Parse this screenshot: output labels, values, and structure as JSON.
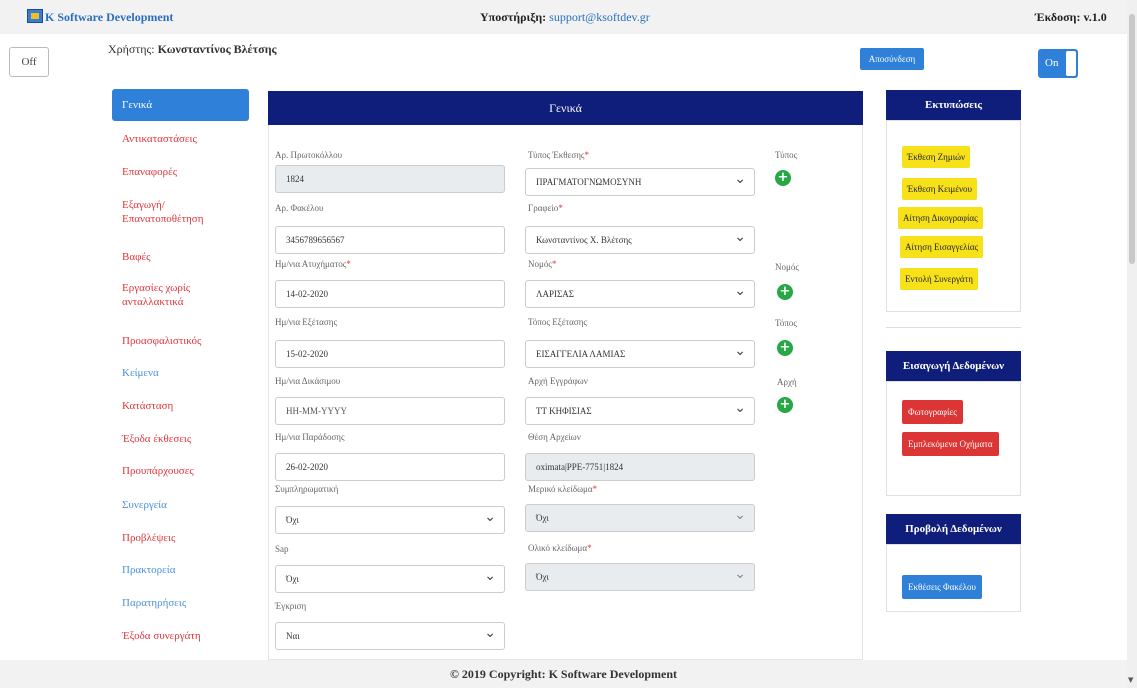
{
  "header": {
    "brand": "K Software Development",
    "support_label": "Υποστήριξη:",
    "support_email": "support@ksoftdev.gr",
    "version": "Έκδοση: v.1.0"
  },
  "user_bar": {
    "off_label": "Off",
    "user_label": "Χρήστης:",
    "user_name": "Κωνσταντίνος Βλέτσης",
    "logout_label": "Αποσύνδεση",
    "on_label": "On"
  },
  "sidebar": {
    "items": [
      {
        "label": "Γενικά"
      },
      {
        "label": "Αντικαταστάσεις"
      },
      {
        "label": "Επαναφορές"
      },
      {
        "label": "Εξαγωγή/ Επανατοποθέτηση"
      },
      {
        "label": "Βαφές"
      },
      {
        "label": "Εργασίες χωρίς ανταλλακτικά"
      },
      {
        "label": "Προασφαλιστικός"
      },
      {
        "label": "Κείμενα"
      },
      {
        "label": "Κατάσταση"
      },
      {
        "label": "Έξοδα έκθεσεις"
      },
      {
        "label": "Προυπάρχουσες"
      },
      {
        "label": "Συνεργεία"
      },
      {
        "label": "Προβλέψεις"
      },
      {
        "label": "Πρακτορεία"
      },
      {
        "label": "Παρατηρήσεις"
      },
      {
        "label": "Έξοδα συνεργάτη"
      }
    ]
  },
  "panel": {
    "title": "Γενικά",
    "fields": {
      "protocol": {
        "label": "Αρ. Πρωτοκόλλου",
        "value": "1824"
      },
      "folder": {
        "label": "Αρ. Φακέλου",
        "value": "3456789656567"
      },
      "accident_date": {
        "label": "Ημ/νια Ατυχήματος",
        "value": "14-02-2020"
      },
      "exam_date": {
        "label": "Ημ/νια Εξέτασης",
        "value": "15-02-2020"
      },
      "trial_date": {
        "label": "Ημ/νια Δικάσιμου",
        "value": "",
        "placeholder": "HH-MM-YYYY"
      },
      "delivery_date": {
        "label": "Ημ/νια Παράδοσης",
        "value": "26-02-2020"
      },
      "supplementary": {
        "label": "Συμπληρωματική",
        "value": "Όχι"
      },
      "sap": {
        "label": "Sap",
        "value": "Όχι"
      },
      "approval": {
        "label": "Έγκριση",
        "value": "Ναι"
      },
      "report_type": {
        "label": "Τύπος Έκθεσης",
        "value": "ΠΡΑΓΜΑΤΟΓΝΩΜΟΣΥΝΗ"
      },
      "office": {
        "label": "Γραφείο",
        "value": "Κωνσταντίνος Χ. Βλέτσης"
      },
      "prefecture": {
        "label": "Νομός",
        "value": "ΛΑΡΙΣΑΣ"
      },
      "exam_place": {
        "label": "Τόπος Εξέτασης",
        "value": "ΕΙΣΑΓΓΕΛΙΑ ΛΑΜΙΑΣ"
      },
      "registry": {
        "label": "Αρχή Εγγράφων",
        "value": "ΤΤ ΚΗΦΙΣΙΑΣ"
      },
      "archive_position": {
        "label": "Θέση Αρχείων",
        "value": "oximata|PPE-7751|1824"
      },
      "partial_lock": {
        "label": "Μερικό κλείδωμα",
        "value": "Όχι"
      },
      "total_lock": {
        "label": "Ολικό κλείδωμα",
        "value": "Όχι"
      }
    },
    "add_labels": {
      "type": "Τύπος",
      "prefecture": "Νομός",
      "place": "Τόπος",
      "authority": "Αρχή"
    }
  },
  "right": {
    "prints": {
      "title": "Εκτυπώσεις",
      "buttons": [
        "Έκθεση Ζημιών",
        "Έκθεση Κειμένου",
        "Αίτηση Δικογραφίας",
        "Αίτηση Εισαγγελίας",
        "Εντολή Συνεργάτη"
      ]
    },
    "data_entry": {
      "title": "Εισαγωγή Δεδομένων",
      "buttons": [
        "Φωτογραφίες",
        "Εμπλεκόμενα Οχήματα"
      ]
    },
    "data_view": {
      "title": "Προβολή Δεδομένων",
      "buttons": [
        "Εκθέσεις Φακέλου"
      ]
    }
  },
  "footer": {
    "text": "© 2019 Copyright: K Software Development"
  },
  "colors": {
    "primary": "#2f80d9",
    "navy": "#0f1e7a",
    "danger": "#e0343a",
    "warning": "#f7e21a",
    "success": "#28a745"
  }
}
